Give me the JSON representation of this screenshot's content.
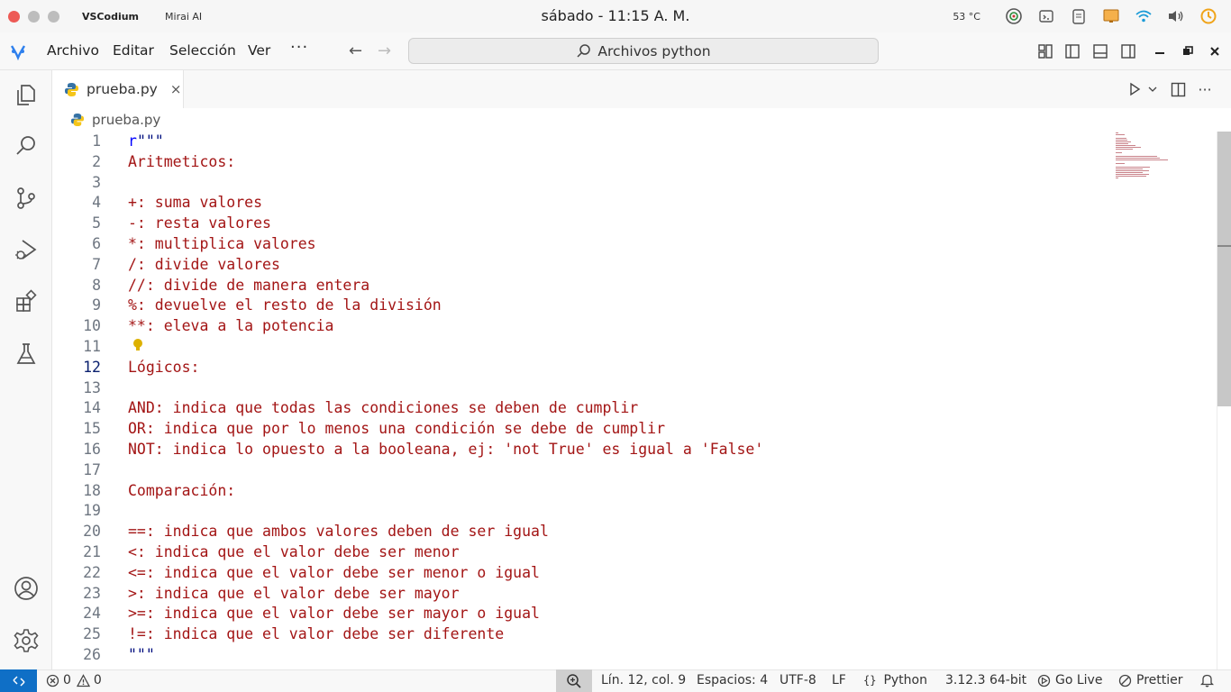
{
  "os": {
    "app_name": "VSCodium",
    "window_title": "Mirai AI",
    "clock": "sábado - 11:15 A. M.",
    "temperature": "53 °C"
  },
  "menu": {
    "items": [
      "Archivo",
      "Editar",
      "Selección",
      "Ver"
    ],
    "more": "···"
  },
  "command_center": {
    "label": "Archivos python"
  },
  "tab": {
    "label": "prueba.py",
    "close": "×"
  },
  "breadcrumb": {
    "file": "prueba.py"
  },
  "editor": {
    "active_line": 12,
    "lines": [
      {
        "n": "1",
        "text": "r\"\"\""
      },
      {
        "n": "2",
        "text": "Aritmeticos:"
      },
      {
        "n": "3",
        "text": ""
      },
      {
        "n": "4",
        "text": "+: suma valores"
      },
      {
        "n": "5",
        "text": "-: resta valores"
      },
      {
        "n": "6",
        "text": "*: multiplica valores"
      },
      {
        "n": "7",
        "text": "/: divide valores"
      },
      {
        "n": "8",
        "text": "//: divide de manera entera"
      },
      {
        "n": "9",
        "text": "%: devuelve el resto de la división"
      },
      {
        "n": "10",
        "text": "**: eleva a la potencia"
      },
      {
        "n": "11",
        "text": ""
      },
      {
        "n": "12",
        "text": "Lógicos:"
      },
      {
        "n": "13",
        "text": ""
      },
      {
        "n": "14",
        "text": "AND: indica que todas las condiciones se deben de cumplir"
      },
      {
        "n": "15",
        "text": "OR: indica que por lo menos una condición se debe de cumplir"
      },
      {
        "n": "16",
        "text": "NOT: indica lo opuesto a la booleana, ej: 'not True' es igual a 'False'"
      },
      {
        "n": "17",
        "text": ""
      },
      {
        "n": "18",
        "text": "Comparación:"
      },
      {
        "n": "19",
        "text": ""
      },
      {
        "n": "20",
        "text": "==: indica que ambos valores deben de ser igual"
      },
      {
        "n": "21",
        "text": "<: indica que el valor debe ser menor"
      },
      {
        "n": "22",
        "text": "<=: indica que el valor debe ser menor o igual"
      },
      {
        "n": "23",
        "text": ">: indica que el valor debe ser mayor"
      },
      {
        "n": "24",
        "text": ">=: indica que el valor debe ser mayor o igual"
      },
      {
        "n": "25",
        "text": "!=: indica que el valor debe ser diferente"
      },
      {
        "n": "26",
        "text": "\"\"\""
      }
    ]
  },
  "status": {
    "errors": "0",
    "warnings": "0",
    "position": "Lín. 12, col. 9",
    "spaces": "Espacios: 4",
    "encoding": "UTF-8",
    "eol": "LF",
    "language": "Python",
    "interpreter": "3.12.3 64-bit",
    "golive": "Go Live",
    "prettier": "Prettier"
  },
  "colors": {
    "string": "#a31515",
    "prefix": "#0000ff",
    "accent": "#0f6fc6"
  }
}
